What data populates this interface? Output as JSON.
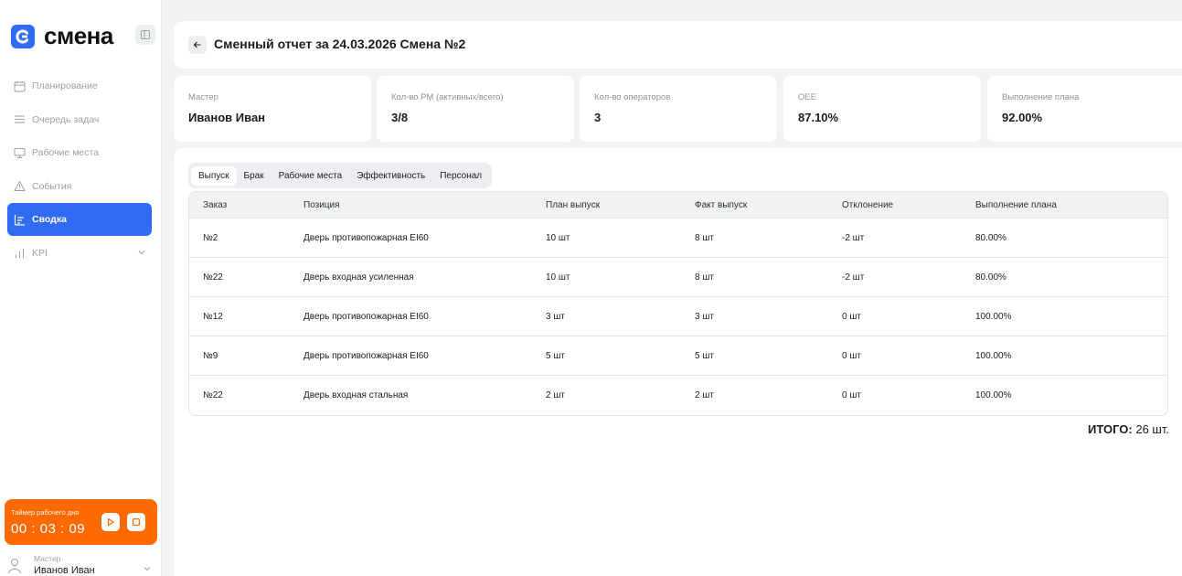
{
  "app": {
    "name": "смена",
    "logo_letter": "C",
    "accent": "#2f6bf5",
    "timer_color": "#ff6a00"
  },
  "sidebar": {
    "items": [
      {
        "label": "Планирование",
        "icon": "calendar-icon"
      },
      {
        "label": "Очередь задач",
        "icon": "list-icon"
      },
      {
        "label": "Рабочие места",
        "icon": "monitor-icon"
      },
      {
        "label": "События",
        "icon": "warning-icon"
      },
      {
        "label": "Сводка",
        "icon": "summary-icon",
        "active": true
      },
      {
        "label": "KPI",
        "icon": "bar-chart-icon",
        "expandable": true
      }
    ]
  },
  "timer": {
    "label": "Таймер рабочего дня",
    "value": "00 : 03 : 09",
    "play_icon": "play-icon",
    "stop_icon": "stop-icon"
  },
  "user": {
    "role": "Мастер",
    "name": "Иванов Иван"
  },
  "header": {
    "title": "Сменный отчет за 24.03.2026 Смена №2"
  },
  "cards": [
    {
      "label": "Мастер",
      "value": "Иванов Иван"
    },
    {
      "label": "Кол-во РМ (активных/всего)",
      "value": "3/8"
    },
    {
      "label": "Кол-во операторов",
      "value": "3"
    },
    {
      "label": "OEE",
      "value": "87.10%"
    },
    {
      "label": "Выполнение плана",
      "value": "92.00%"
    }
  ],
  "tabs": [
    {
      "label": "Выпуск",
      "active": true
    },
    {
      "label": "Брак"
    },
    {
      "label": "Рабочие места"
    },
    {
      "label": "Эффективность"
    },
    {
      "label": "Персонал"
    }
  ],
  "table": {
    "columns": [
      "Заказ",
      "Позиция",
      "План выпуск",
      "Факт выпуск",
      "Отклонение",
      "Выполнение плана"
    ],
    "rows": [
      [
        "№2",
        "Дверь противопожарная EI60",
        "10 шт",
        "8 шт",
        "-2 шт",
        "80.00%"
      ],
      [
        "№22",
        "Дверь входная усиленная",
        "10 шт",
        "8 шт",
        "-2 шт",
        "80.00%"
      ],
      [
        "№12",
        "Дверь противопожарная EI60",
        "3 шт",
        "3 шт",
        "0 шт",
        "100.00%"
      ],
      [
        "№9",
        "Дверь противопожарная EI60",
        "5 шт",
        "5 шт",
        "0 шт",
        "100.00%"
      ],
      [
        "№22",
        "Дверь входная стальная",
        "2 шт",
        "2 шт",
        "0 шт",
        "100.00%"
      ]
    ]
  },
  "total": {
    "label": "ИТОГО:",
    "value": "26 шт."
  }
}
